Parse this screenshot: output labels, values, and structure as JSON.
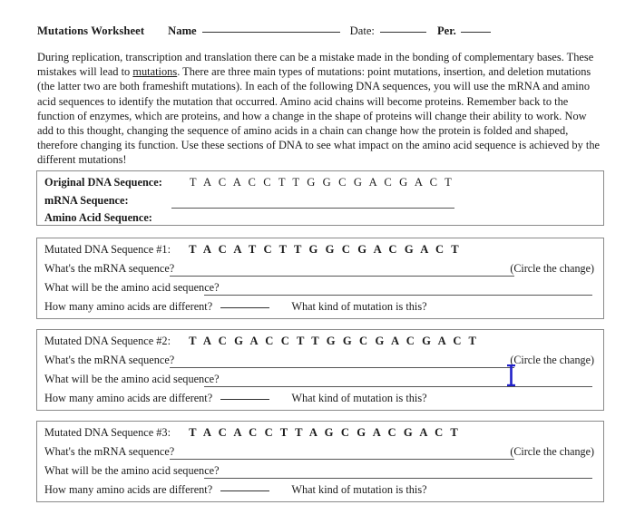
{
  "header": {
    "title": "Mutations Worksheet",
    "name_label": "Name",
    "date_label": "Date:",
    "period_label": "Per."
  },
  "intro": {
    "part1": "During replication, transcription and translation there can be a mistake made in the bonding of complementary bases. These mistakes will lead to ",
    "underlined_term": "mutations",
    "part2": ". There are three main types of mutations: point mutations, insertion, and deletion mutations (the latter two are both frameshift mutations).  In each of the following DNA sequences, you will use the mRNA and amino acid sequences to identify the mutation that occurred.  Amino acid chains will become proteins. Remember back to the function of enzymes, which are proteins, and how a change in the shape of proteins will change their ability to work. Now add to this thought, changing the sequence of amino acids in a chain can change how the protein is folded and shaped, therefore changing its function. Use these sections of DNA to see what impact on the amino acid sequence is achieved by the different mutations!"
  },
  "original_box": {
    "dna_label": "Original DNA Sequence:",
    "dna_sequence": "T A C A C C T T G G C G A C G A C T",
    "mrna_label": "mRNA Sequence:",
    "amino_label": "Amino Acid Sequence:"
  },
  "mutations": [
    {
      "label": "Mutated DNA Sequence #1:",
      "dna_sequence": "T A C A T C T T G G C G A C G A C T",
      "q_mrna": "What's the mRNA sequence?",
      "circle_note": "(Circle the change)",
      "q_amino": "What will be the amino acid sequence?",
      "q_count": "How many amino acids are different?",
      "q_kind": "What kind of mutation is this?"
    },
    {
      "label": "Mutated DNA Sequence #2:",
      "dna_sequence": "T A C G A C C T T G G C G A C G A C T",
      "q_mrna": "What's the mRNA sequence?",
      "circle_note": "(Circle the change)",
      "q_amino": "What will be the amino acid sequence?",
      "q_count": "How many amino acids are different?",
      "q_kind": "What kind of mutation is this?"
    },
    {
      "label": "Mutated DNA Sequence #3:",
      "dna_sequence": "T A C A C C T T A G C G A C G A C T",
      "q_mrna": "What's the mRNA sequence?",
      "circle_note": "(Circle the change)",
      "q_amino": "What will be the amino acid sequence?",
      "q_count": "How many amino acids are different?",
      "q_kind": "What kind of mutation is this?"
    }
  ],
  "cursor": {
    "color": "#2020c8"
  }
}
